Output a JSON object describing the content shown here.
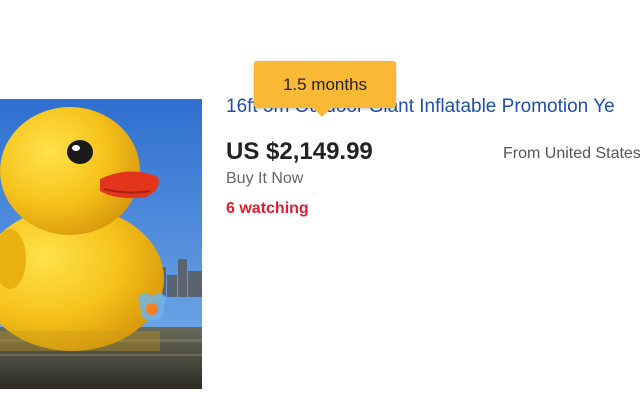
{
  "listing": {
    "title": "16ft 5m Outdoor Giant Inflatable Promotion Ye",
    "price": "US $2,149.99",
    "format": "Buy It Now",
    "watching": "6 watching",
    "location": "From United States"
  },
  "tooltip": {
    "text": "1.5 months"
  },
  "colors": {
    "title_link": "#1f4fa8",
    "watching": "#dd1e31",
    "tooltip_bg": "#f9b935",
    "price": "#222222"
  },
  "image": {
    "subject": "giant-inflatable-rubber-duck"
  }
}
